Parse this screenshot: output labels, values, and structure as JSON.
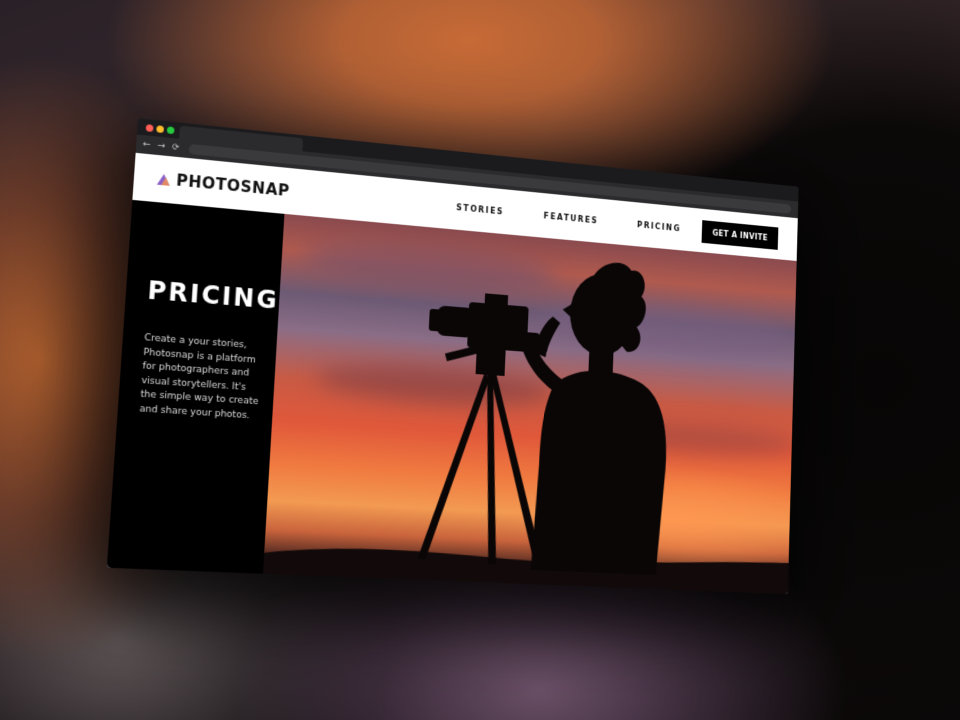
{
  "website": {
    "logo_text": "PHOTOSNAP",
    "nav": [
      {
        "label": "STORIES"
      },
      {
        "label": "FEATURES"
      },
      {
        "label": "PRICING"
      }
    ],
    "cta_label": "GET A INVITE",
    "hero": {
      "title": "PRICING",
      "description": "Create a your stories, Photosnap is a platform for photographers and visual storytellers. It's the simple way to create and share your photos."
    }
  },
  "icons": {
    "back": "arrow-left-icon",
    "forward": "arrow-right-icon",
    "reload": "reload-icon",
    "logo": "triangle-logo-icon"
  },
  "colors": {
    "accent_black": "#000000",
    "logo_purple": "#8a5fc8",
    "logo_peach": "#e08a64",
    "sunset_orange": "#f07a40"
  }
}
